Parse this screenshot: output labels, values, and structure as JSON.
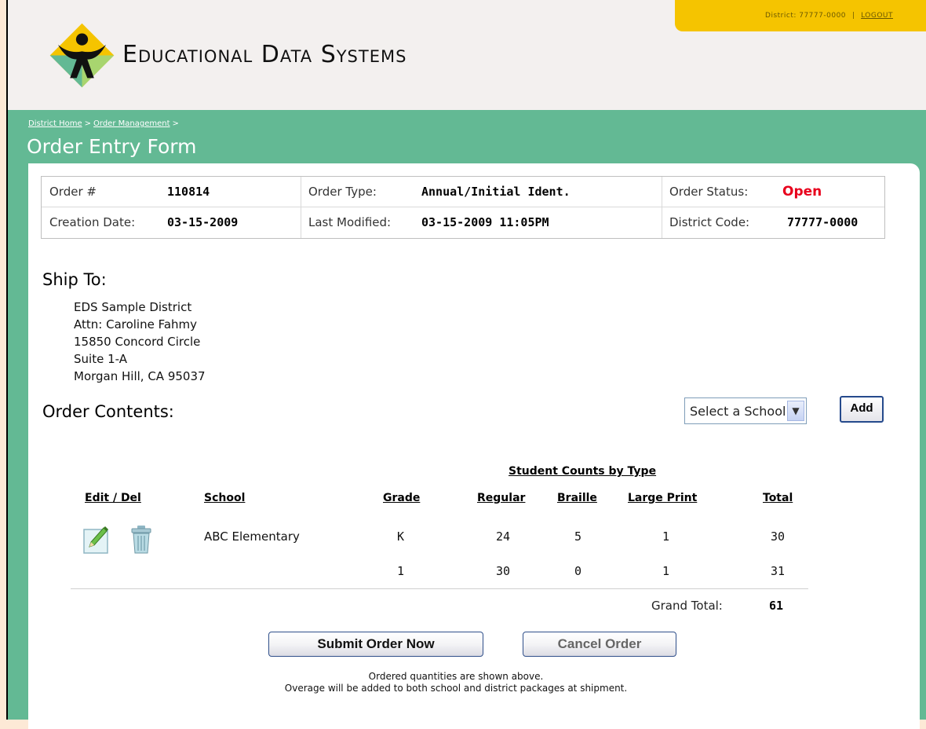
{
  "topbar": {
    "district": "District: 77777-0000",
    "separator": "|",
    "logout": "LOGOUT"
  },
  "brand": {
    "name": "Educational Data Systems",
    "colors": {
      "yellow": "#f5c400",
      "green": "#63b994",
      "dark": "#111111"
    }
  },
  "breadcrumb": {
    "items": [
      "District Home",
      "Order Management"
    ],
    "separator": ">"
  },
  "page": {
    "title": "Order Entry Form"
  },
  "order": {
    "number_label": "Order #",
    "number": "110814",
    "type_label": "Order Type:",
    "type": "Annual/Initial Ident.",
    "status_label": "Order Status:",
    "status": "Open",
    "creation_label": "Creation Date:",
    "creation": "03-15-2009",
    "modified_label": "Last Modified:",
    "modified": "03-15-2009 11:05PM",
    "district_label": "District Code:",
    "district": "77777-0000"
  },
  "ship_to": {
    "title": "Ship To:",
    "lines": [
      "EDS Sample District",
      "Attn: Caroline Fahmy",
      "15850 Concord Circle",
      "Suite 1-A",
      "Morgan Hill, CA 95037"
    ]
  },
  "contents": {
    "title": "Order Contents:",
    "select_value": "Select a School",
    "add_label": "Add",
    "group_header": "Student Counts by Type",
    "headers": {
      "edit_del": "Edit / Del",
      "school": "School",
      "grade": "Grade",
      "regular": "Regular",
      "braille": "Braille",
      "large_print": "Large Print",
      "total": "Total"
    },
    "rows": [
      {
        "school": "ABC Elementary",
        "grade": "K",
        "regular": "24",
        "braille": "5",
        "large_print": "1",
        "total": "30"
      },
      {
        "school": "",
        "grade": "1",
        "regular": "30",
        "braille": "0",
        "large_print": "1",
        "total": "31"
      }
    ],
    "grand_total_label": "Grand Total:",
    "grand_total": "61",
    "icons": {
      "edit": "pencil-icon",
      "delete": "trash-icon"
    }
  },
  "actions": {
    "submit": "Submit Order Now",
    "cancel": "Cancel Order"
  },
  "note": {
    "line1": "Ordered quantities are shown above.",
    "line2": "Overage will be added to both school and district packages at shipment."
  }
}
